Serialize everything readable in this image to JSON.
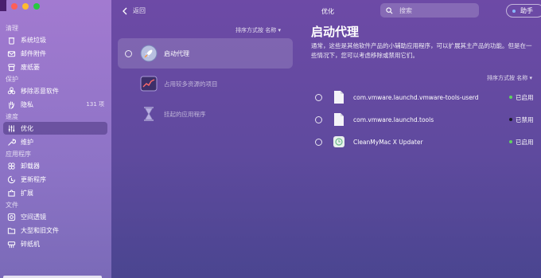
{
  "header": {
    "back_label": "返回",
    "title": "优化",
    "search_placeholder": "搜索",
    "assistant_label": "助手"
  },
  "sidebar": {
    "sections": [
      {
        "title": "清理",
        "items": [
          {
            "label": "系统垃圾",
            "icon": "trash-icon"
          },
          {
            "label": "邮件附件",
            "icon": "mail-icon"
          },
          {
            "label": "废纸篓",
            "icon": "bin-icon"
          }
        ]
      },
      {
        "title": "保护",
        "items": [
          {
            "label": "移除恶意软件",
            "icon": "biohazard-icon"
          },
          {
            "label": "隐私",
            "icon": "hand-icon",
            "count": "131 项"
          }
        ]
      },
      {
        "title": "速度",
        "items": [
          {
            "label": "优化",
            "icon": "sliders-icon",
            "active": true
          },
          {
            "label": "维护",
            "icon": "wrench-icon"
          }
        ]
      },
      {
        "title": "应用程序",
        "items": [
          {
            "label": "卸载器",
            "icon": "uninstaller-icon"
          },
          {
            "label": "更新程序",
            "icon": "updater-icon"
          },
          {
            "label": "扩展",
            "icon": "extensions-icon"
          }
        ]
      },
      {
        "title": "文件",
        "items": [
          {
            "label": "空间透镜",
            "icon": "lens-icon"
          },
          {
            "label": "大型和旧文件",
            "icon": "folder-icon"
          },
          {
            "label": "碎纸机",
            "icon": "shredder-icon"
          }
        ]
      }
    ]
  },
  "middle": {
    "sort_label": "排序方式按 名称 ▾",
    "items": [
      {
        "label": "启动代理",
        "icon": "rocket-icon"
      },
      {
        "label": "占用较多资源的项目",
        "icon": "chart-icon"
      },
      {
        "label": "挂起的应用程序",
        "icon": "hourglass-icon"
      }
    ]
  },
  "detail": {
    "title": "启动代理",
    "description": "通常，这些是其他软件产品的小辅助应用程序，可以扩展其主产品的功能。但是在一些情况下，您可以考虑移除或禁用它们。",
    "sort_label": "排序方式按 名称 ▾",
    "rows": [
      {
        "name": "com.vmware.launchd.vmware-tools-userd",
        "status": "已启用",
        "status_color": "#5fd35f",
        "icon": "file-icon"
      },
      {
        "name": "com.vmware.launchd.tools",
        "status": "已禁用",
        "status_color": "#1a1a2a",
        "icon": "file-icon"
      },
      {
        "name": "CleanMyMac X Updater",
        "status": "已启用",
        "status_color": "#5fd35f",
        "icon": "updater-app-icon"
      }
    ]
  }
}
